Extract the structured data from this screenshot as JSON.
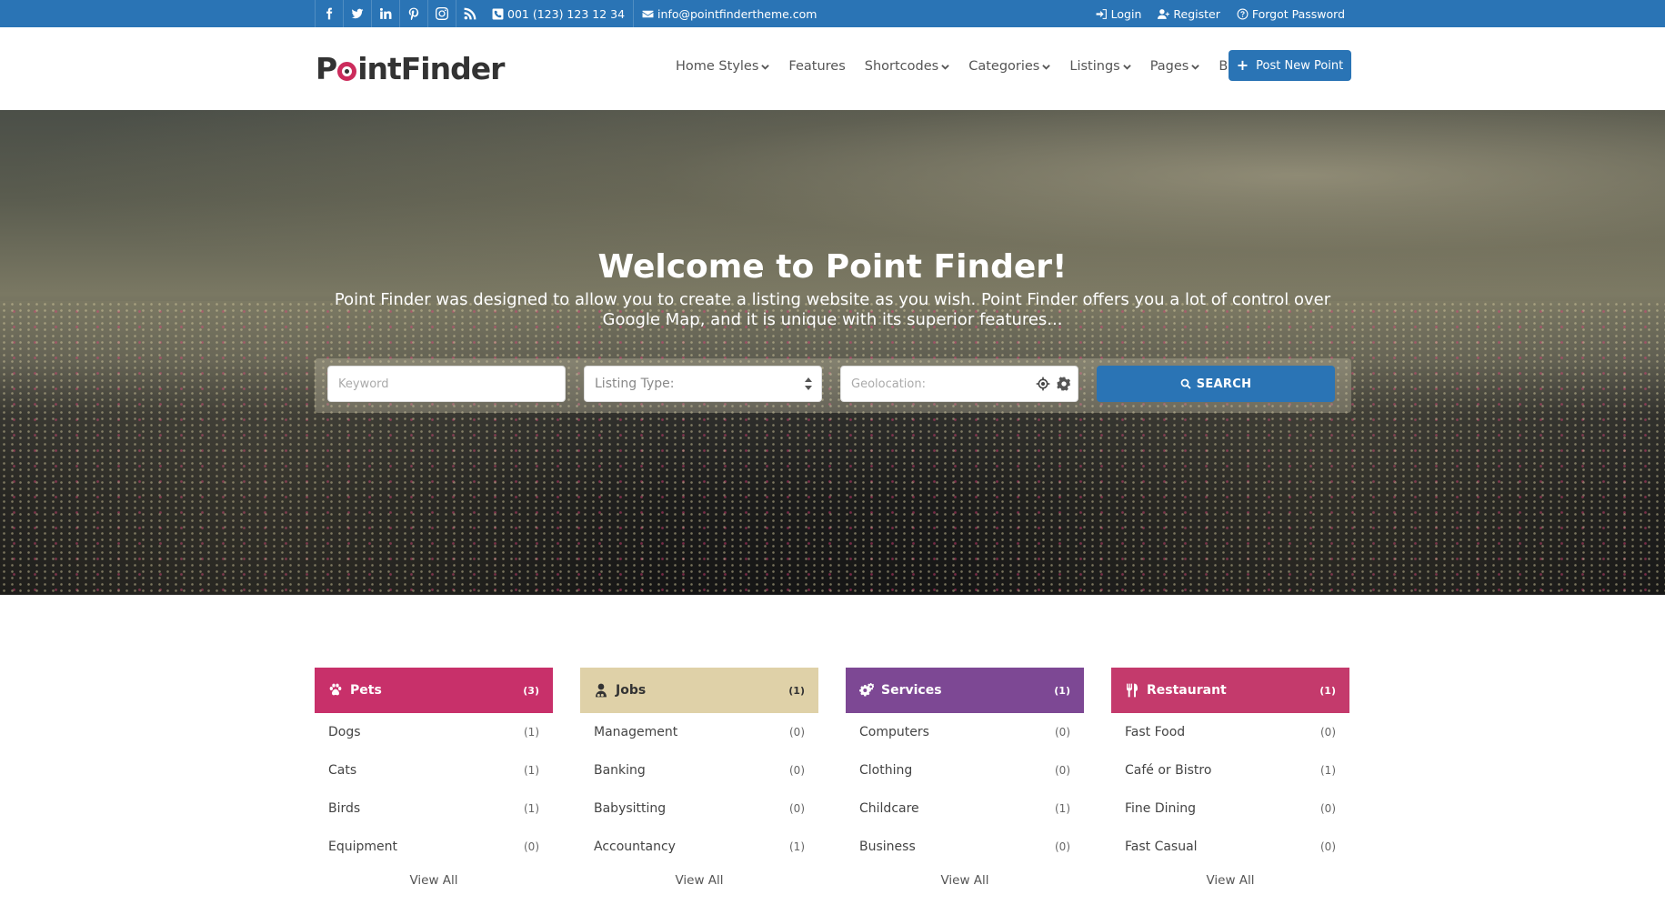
{
  "topbar": {
    "social": [
      "facebook-icon",
      "twitter-icon",
      "linkedin-icon",
      "pinterest-icon",
      "instagram-icon",
      "rss-icon"
    ],
    "phone": "001 (123) 123 12 34",
    "email": "info@pointfindertheme.com",
    "login": "Login",
    "register": "Register",
    "forgot": "Forgot Password"
  },
  "header": {
    "logo_p": "P",
    "logo_rest": "intFinder",
    "nav": [
      {
        "label": "Home Styles",
        "dropdown": true
      },
      {
        "label": "Features",
        "dropdown": false
      },
      {
        "label": "Shortcodes",
        "dropdown": true
      },
      {
        "label": "Categories",
        "dropdown": true
      },
      {
        "label": "Listings",
        "dropdown": true
      },
      {
        "label": "Pages",
        "dropdown": true
      },
      {
        "label": "Blog",
        "dropdown": true
      }
    ],
    "post_button": "Post New Point"
  },
  "hero": {
    "title": "Welcome to Point Finder!",
    "subtitle": "Point Finder was designed to allow you to create a listing website as you wish. Point Finder offers you a lot of control over Google Map, and it is unique with its superior features..."
  },
  "search": {
    "keyword_placeholder": "Keyword",
    "listing_type": "Listing Type:",
    "geolocation_placeholder": "Geolocation:",
    "button": "SEARCH"
  },
  "categories": [
    {
      "name": "Pets",
      "count": "(3)",
      "color": "#c8306a",
      "text_color": "#ffffff",
      "icon": "paw-icon",
      "items": [
        {
          "label": "Dogs",
          "count": "(1)"
        },
        {
          "label": "Cats",
          "count": "(1)"
        },
        {
          "label": "Birds",
          "count": "(1)"
        },
        {
          "label": "Equipment",
          "count": "(0)"
        }
      ],
      "view_all": "View All"
    },
    {
      "name": "Jobs",
      "count": "(1)",
      "color": "#dfd1a8",
      "text_color": "#333333",
      "icon": "user-group-icon",
      "items": [
        {
          "label": "Management",
          "count": "(0)"
        },
        {
          "label": "Banking",
          "count": "(0)"
        },
        {
          "label": "Babysitting",
          "count": "(0)"
        },
        {
          "label": "Accountancy",
          "count": "(1)"
        }
      ],
      "view_all": "View All"
    },
    {
      "name": "Services",
      "count": "(1)",
      "color": "#7d4894",
      "text_color": "#ffffff",
      "icon": "gears-icon",
      "items": [
        {
          "label": "Computers",
          "count": "(0)"
        },
        {
          "label": "Clothing",
          "count": "(0)"
        },
        {
          "label": "Childcare",
          "count": "(1)"
        },
        {
          "label": "Business",
          "count": "(0)"
        }
      ],
      "view_all": "View All"
    },
    {
      "name": "Restaurant",
      "count": "(1)",
      "color": "#c43a6c",
      "text_color": "#ffffff",
      "icon": "cutlery-icon",
      "items": [
        {
          "label": "Fast Food",
          "count": "(0)"
        },
        {
          "label": "Café or Bistro",
          "count": "(1)"
        },
        {
          "label": "Fine Dining",
          "count": "(0)"
        },
        {
          "label": "Fast Casual",
          "count": "(0)"
        }
      ],
      "view_all": "View All"
    }
  ]
}
